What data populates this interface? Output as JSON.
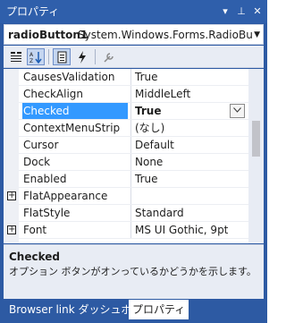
{
  "window": {
    "title": "プロパティ",
    "buttons": {
      "dropdown": "▾",
      "pin": "⊥",
      "close": "✕"
    }
  },
  "object_selector": {
    "name": "radioButton1",
    "type": "System.Windows.Forms.RadioButton"
  },
  "toolbar": {
    "icons": [
      "categorized-icon",
      "alphabetical-icon",
      "properties-icon",
      "events-icon",
      "property-pages-icon"
    ]
  },
  "properties": [
    {
      "name": "CausesValidation",
      "value": "True",
      "expandable": false
    },
    {
      "name": "CheckAlign",
      "value": "MiddleLeft",
      "expandable": false
    },
    {
      "name": "Checked",
      "value": "True",
      "expandable": false,
      "selected": true
    },
    {
      "name": "ContextMenuStrip",
      "value": "(なし)",
      "expandable": false
    },
    {
      "name": "Cursor",
      "value": "Default",
      "expandable": false
    },
    {
      "name": "Dock",
      "value": "None",
      "expandable": false
    },
    {
      "name": "Enabled",
      "value": "True",
      "expandable": false
    },
    {
      "name": "FlatAppearance",
      "value": "",
      "expandable": true
    },
    {
      "name": "FlatStyle",
      "value": "Standard",
      "expandable": false
    },
    {
      "name": "Font",
      "value": "MS UI Gothic, 9pt",
      "expandable": true
    }
  ],
  "description": {
    "title": "Checked",
    "text": "オプション ボタンがオンっているかどうかを示します。"
  },
  "tabs": [
    {
      "label": "Browser link ダッシュボード",
      "active": false
    },
    {
      "label": "プロパティ",
      "active": true
    }
  ],
  "colors": {
    "frame": "#2d5aa3",
    "selection": "#3399ff"
  }
}
